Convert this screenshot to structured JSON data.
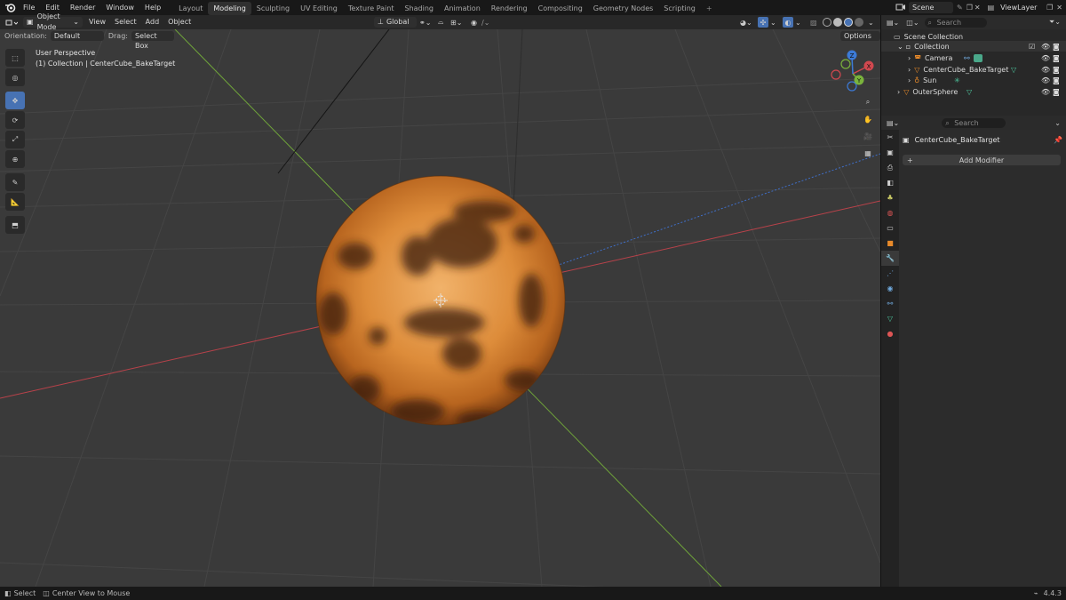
{
  "app": {
    "version": "4.4.3"
  },
  "menu": [
    "File",
    "Edit",
    "Render",
    "Window",
    "Help"
  ],
  "workspaces": [
    {
      "label": "Layout",
      "active": false
    },
    {
      "label": "Modeling",
      "active": true
    },
    {
      "label": "Sculpting",
      "active": false
    },
    {
      "label": "UV Editing",
      "active": false
    },
    {
      "label": "Texture Paint",
      "active": false
    },
    {
      "label": "Shading",
      "active": false
    },
    {
      "label": "Animation",
      "active": false
    },
    {
      "label": "Rendering",
      "active": false
    },
    {
      "label": "Compositing",
      "active": false
    },
    {
      "label": "Geometry Nodes",
      "active": false
    },
    {
      "label": "Scripting",
      "active": false
    }
  ],
  "topbar": {
    "scene": "Scene",
    "view_layer": "ViewLayer"
  },
  "header": {
    "mode": "Object Mode",
    "menus": [
      "View",
      "Select",
      "Add",
      "Object"
    ],
    "transform_orientation": "Global"
  },
  "subheader": {
    "orientation_label": "Orientation:",
    "orientation_value": "Default",
    "drag_label": "Drag:",
    "drag_value": "Select Box",
    "options": "Options"
  },
  "viewport": {
    "perspective": "User Perspective",
    "context": "(1) Collection | CenterCube_BakeTarget",
    "gizmo_axes": [
      "X",
      "Y",
      "Z"
    ]
  },
  "tools": [
    "select-box",
    "cursor",
    "move",
    "rotate",
    "scale",
    "transform",
    "annotate",
    "measure",
    "add-cube"
  ],
  "outliner": {
    "search_placeholder": "Search",
    "root": "Scene Collection",
    "items": [
      {
        "name": "Collection",
        "depth": 1
      },
      {
        "name": "Camera",
        "depth": 2
      },
      {
        "name": "CenterCube_BakeTarget",
        "depth": 2
      },
      {
        "name": "Sun",
        "depth": 2
      },
      {
        "name": "OuterSphere",
        "depth": 1
      }
    ]
  },
  "properties": {
    "search_placeholder": "Search",
    "object_name": "CenterCube_BakeTarget",
    "add_modifier": "Add Modifier"
  },
  "statusbar": {
    "select": "Select",
    "center_view": "Center View to Mouse"
  },
  "colors": {
    "accent": "#4772b3",
    "x_axis": "#d0484f",
    "y_axis": "#7ab33c",
    "z_axis": "#3c7ad6",
    "object_orange": "#e88a2a"
  }
}
